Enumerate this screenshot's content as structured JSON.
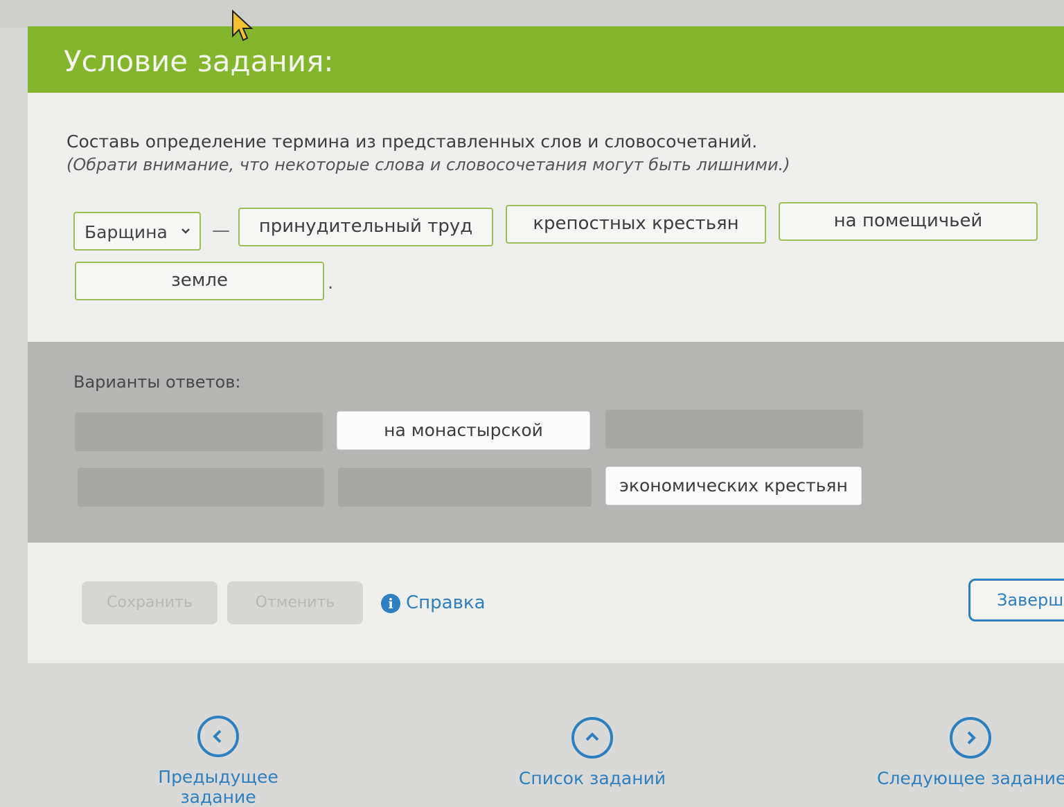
{
  "header": {
    "title": "Условие задания:"
  },
  "task": {
    "instruction": "Составь определение термина из представленных слов и словосочетаний.",
    "hint": "(Обрати внимание, что некоторые слова и словосочетания могут быть лишними.)"
  },
  "definition": {
    "term_select": "Барщина",
    "dash": "—",
    "slots": [
      "принудительный труд",
      "крепостных крестьян",
      "на помещичьей",
      "земле"
    ],
    "period": "."
  },
  "answers": {
    "title": "Варианты ответов:",
    "chips": [
      "на монастырской",
      "экономических крестьян"
    ]
  },
  "actions": {
    "save": "Сохранить",
    "cancel": "Отменить",
    "help": "Справка",
    "finish": "Заверши"
  },
  "nav": {
    "prev": "Предыдущее задание",
    "list": "Список заданий",
    "next": "Следующее задание"
  },
  "colors": {
    "header_green": "#84b62d",
    "accent_blue": "#2e7fc0",
    "slot_border": "#9cbc55"
  }
}
